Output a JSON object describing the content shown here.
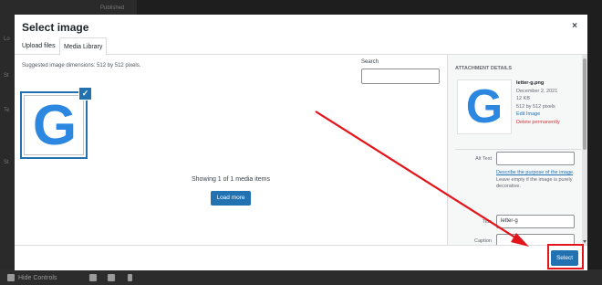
{
  "background": {
    "footer_label": "Hide Controls",
    "text_top": "Published",
    "text_left_1": "Lo",
    "text_left_2": "St",
    "text_left_3": "Te",
    "text_left_4": "St"
  },
  "modal": {
    "title": "Select image",
    "close_label": "×",
    "tabs": [
      {
        "label": "Upload files"
      },
      {
        "label": "Media Library"
      }
    ],
    "suggested_dimensions": "Suggested image dimensions: 512 by 512 pixels.",
    "search_label": "Search",
    "search_placeholder": "",
    "showing_text": "Showing 1 of 1 media items",
    "load_more_label": "Load more",
    "thumb_letter": "G",
    "check_glyph": "✓",
    "select_label": "Select"
  },
  "attachment": {
    "heading": "ATTACHMENT DETAILS",
    "filename": "letter-g.png",
    "date": "December 2, 2021",
    "size": "12 KB",
    "dimensions": "512 by 512 pixels",
    "edit_link": "Edit Image",
    "delete_link": "Delete permanently",
    "alt_label": "Alt Text",
    "alt_value": "",
    "alt_help_link": "Describe the purpose of the image",
    "alt_help_rest": ". Leave empty if the image is purely decorative.",
    "title_label": "Title",
    "title_value": "letter-g",
    "caption_label": "Caption"
  },
  "colors": {
    "accent": "#2271b1",
    "g_blue": "#2c87e0",
    "delete_red": "#d63638",
    "annotation_red": "#e4141b"
  },
  "icons": {
    "close": "close-icon",
    "check": "checkmark-icon"
  }
}
